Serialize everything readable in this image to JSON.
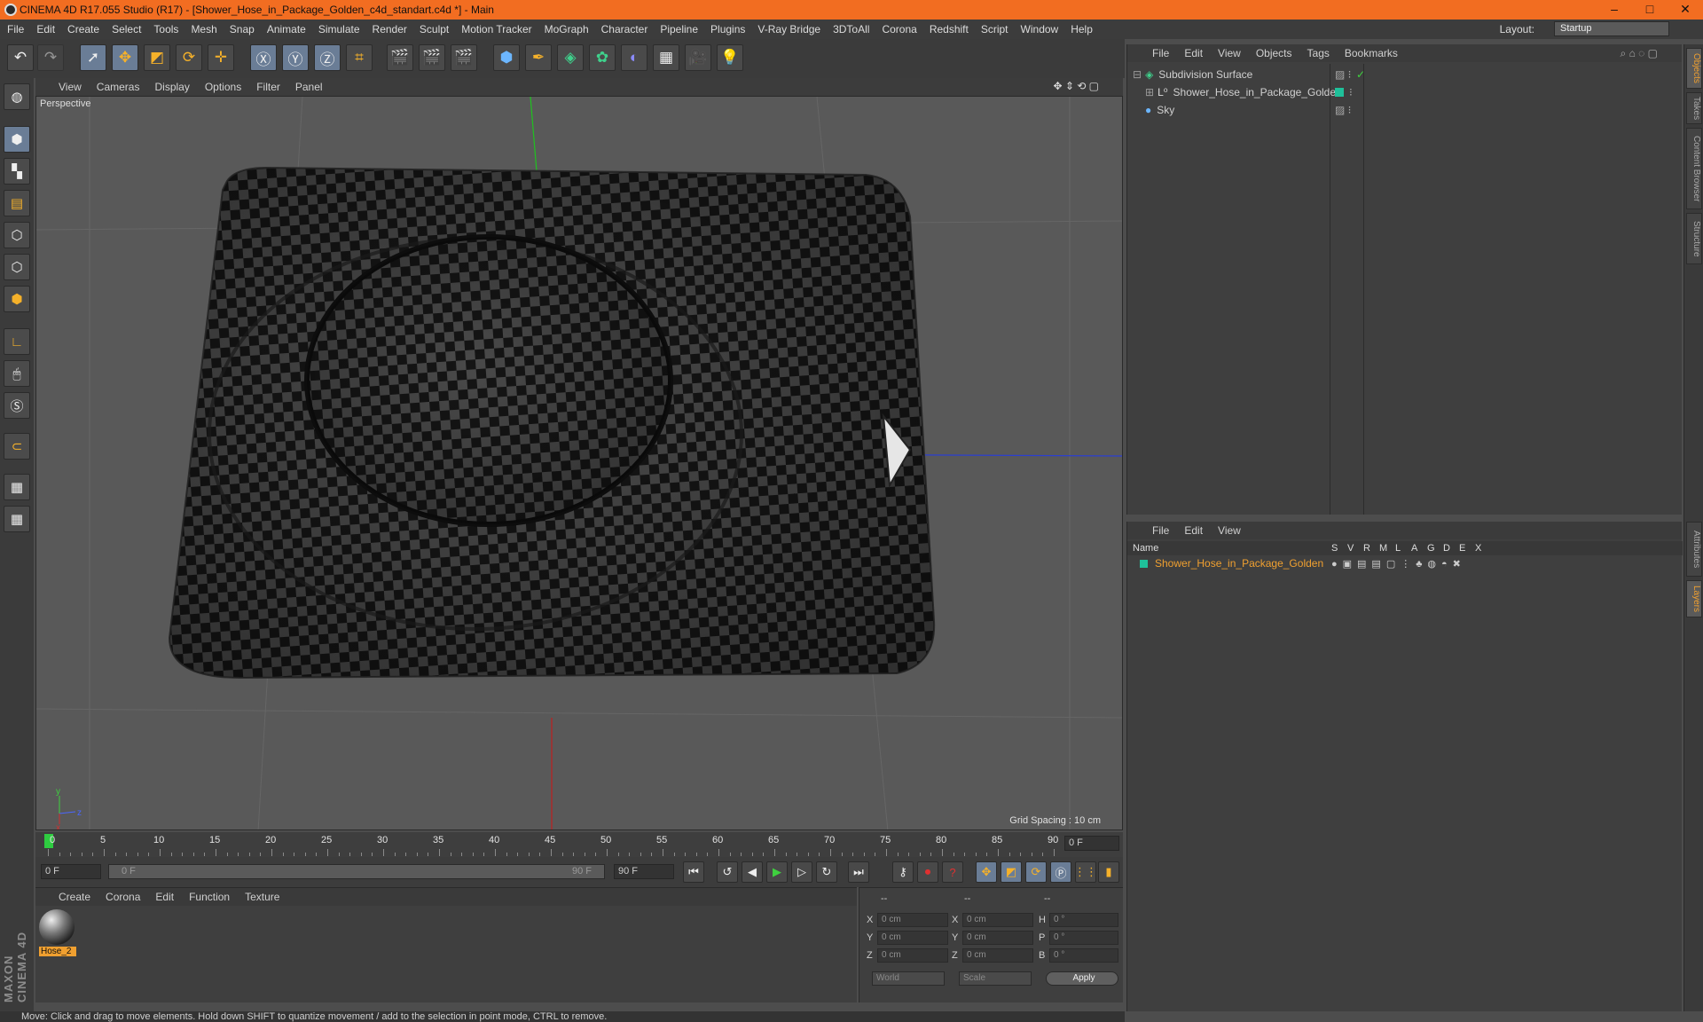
{
  "window": {
    "title": "CINEMA 4D R17.055 Studio (R17) - [Shower_Hose_in_Package_Golden_c4d_standart.c4d *] - Main",
    "minimize": "–",
    "maximize": "□",
    "close": "✕"
  },
  "menu": [
    "File",
    "Edit",
    "Create",
    "Select",
    "Tools",
    "Mesh",
    "Snap",
    "Animate",
    "Simulate",
    "Render",
    "Sculpt",
    "Motion Tracker",
    "MoGraph",
    "Character",
    "Pipeline",
    "Plugins",
    "V-Ray Bridge",
    "3DToAll",
    "Corona",
    "Redshift",
    "Script",
    "Window",
    "Help"
  ],
  "layout": {
    "label": "Layout:",
    "value": "Startup"
  },
  "viewport": {
    "menu": [
      "View",
      "Cameras",
      "Display",
      "Options",
      "Filter",
      "Panel"
    ],
    "label": "Perspective",
    "grid_spacing": "Grid Spacing : 10 cm"
  },
  "timeline": {
    "ticks": [
      "0",
      "5",
      "10",
      "15",
      "20",
      "25",
      "30",
      "35",
      "40",
      "45",
      "50",
      "55",
      "60",
      "65",
      "70",
      "75",
      "80",
      "85",
      "90"
    ],
    "current": "0 F"
  },
  "transport": {
    "start": "0 F",
    "range_start": "0 F",
    "range_end": "90 F",
    "end": "90 F"
  },
  "material": {
    "menu": [
      "Create",
      "Corona",
      "Edit",
      "Function",
      "Texture"
    ],
    "items": [
      {
        "name": "Hose_2"
      }
    ]
  },
  "coords": {
    "head1": "--",
    "head2": "--",
    "head3": "--",
    "x": "X",
    "y": "Y",
    "z": "Z",
    "h": "H",
    "p": "P",
    "b": "B",
    "pos_x": "0 cm",
    "pos_y": "0 cm",
    "pos_z": "0 cm",
    "size_x": "0 cm",
    "size_y": "0 cm",
    "size_z": "0 cm",
    "rot_h": "0 °",
    "rot_p": "0 °",
    "rot_b": "0 °",
    "mode1": "World",
    "mode2": "Scale",
    "apply": "Apply"
  },
  "objects": {
    "menu": [
      "File",
      "Edit",
      "View",
      "Objects",
      "Tags",
      "Bookmarks"
    ],
    "items": [
      {
        "name": "Subdivision Surface"
      },
      {
        "name": "Shower_Hose_in_Package_Golden"
      },
      {
        "name": "Sky"
      }
    ]
  },
  "layers": {
    "menu": [
      "File",
      "Edit",
      "View"
    ],
    "col_name": "Name",
    "cols": [
      "S",
      "V",
      "R",
      "M",
      "L",
      "A",
      "G",
      "D",
      "E",
      "X"
    ],
    "items": [
      {
        "name": "Shower_Hose_in_Package_Golden"
      }
    ]
  },
  "right_tabs": [
    "Objects",
    "Takes",
    "Content Browser",
    "Structure",
    "Attributes",
    "Layers"
  ],
  "status": "Move: Click and drag to move elements. Hold down SHIFT to quantize movement / add to the selection in point mode, CTRL to remove.",
  "brand": "MAXON CINEMA 4D",
  "colors": {
    "title_bar": "#f26d21",
    "accent": "#f0a030",
    "layer_green": "#1fc09a"
  }
}
